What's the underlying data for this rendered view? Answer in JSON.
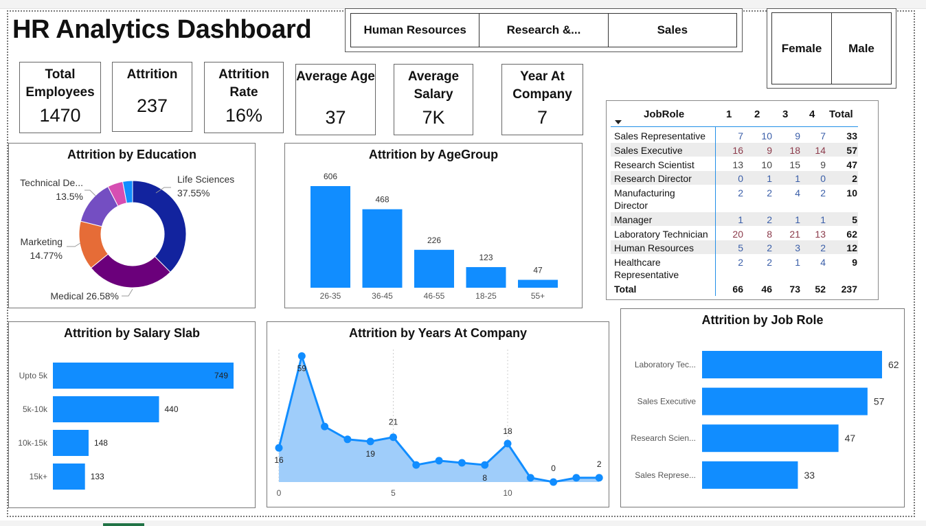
{
  "title": "HR Analytics Dashboard",
  "department_slicer": [
    "Human Resources",
    "Research &...",
    "Sales"
  ],
  "gender_slicer": [
    "Female",
    "Male"
  ],
  "kpis": {
    "total_employees": {
      "label": "Total Employees",
      "value": "1470"
    },
    "attrition": {
      "label": "Attrition",
      "value": "237"
    },
    "attrition_rate": {
      "label": "Attrition Rate",
      "value": "16%"
    },
    "average_age": {
      "label": "Average Age",
      "value": "37"
    },
    "average_salary": {
      "label": "Average Salary",
      "value": "7K"
    },
    "year_at_company": {
      "label": "Year At Company",
      "value": "7"
    }
  },
  "matrix": {
    "headers": [
      "JobRole",
      "1",
      "2",
      "3",
      "4",
      "Total"
    ],
    "rows": [
      {
        "role": "Sales Representative",
        "v": [
          "7",
          "10",
          "9",
          "7"
        ],
        "total": "33"
      },
      {
        "role": "Sales Executive",
        "v": [
          "16",
          "9",
          "18",
          "14"
        ],
        "total": "57"
      },
      {
        "role": "Research Scientist",
        "v": [
          "13",
          "10",
          "15",
          "9"
        ],
        "total": "47"
      },
      {
        "role": "Research Director",
        "v": [
          "0",
          "1",
          "1",
          "0"
        ],
        "total": "2"
      },
      {
        "role": "Manufacturing Director",
        "v": [
          "2",
          "2",
          "4",
          "2"
        ],
        "total": "10"
      },
      {
        "role": "Manager",
        "v": [
          "1",
          "2",
          "1",
          "1"
        ],
        "total": "5"
      },
      {
        "role": "Laboratory Technician",
        "v": [
          "20",
          "8",
          "21",
          "13"
        ],
        "total": "62"
      },
      {
        "role": "Human Resources",
        "v": [
          "5",
          "2",
          "3",
          "2"
        ],
        "total": "12"
      },
      {
        "role": "Healthcare Representative",
        "v": [
          "2",
          "2",
          "1",
          "4"
        ],
        "total": "9"
      }
    ],
    "total_row": {
      "role": "Total",
      "v": [
        "66",
        "46",
        "73",
        "52"
      ],
      "total": "237"
    }
  },
  "colors": {
    "bar": "#118DFF",
    "area": "#9fcdfa",
    "education": [
      "#12239E",
      "#6B007B",
      "#E66C37",
      "#744EC2",
      "#D64EB2",
      "#118DFF"
    ],
    "matrix_blue": "#3a5ea8",
    "matrix_red": "#8b3a4a",
    "matrix_gray": "#444444"
  },
  "chart_data": [
    {
      "type": "pie",
      "title": "Attrition by Education",
      "slices": [
        {
          "label": "Life Sciences",
          "percent_label": "37.55%",
          "value": 37.55
        },
        {
          "label": "Medical",
          "percent_label": "26.58%",
          "value": 26.58
        },
        {
          "label": "Marketing",
          "percent_label": "14.77%",
          "value": 14.77
        },
        {
          "label": "Technical De...",
          "percent_label": "13.5%",
          "value": 13.5
        },
        {
          "label": "",
          "percent_label": "",
          "value": 4.64
        },
        {
          "label": "",
          "percent_label": "",
          "value": 2.96
        }
      ]
    },
    {
      "type": "bar",
      "title": "Attrition by AgeGroup",
      "categories": [
        "26-35",
        "36-45",
        "46-55",
        "18-25",
        "55+"
      ],
      "values": [
        606,
        468,
        226,
        123,
        47
      ]
    },
    {
      "type": "bar",
      "orientation": "horizontal",
      "title": "Attrition by Salary Slab",
      "categories": [
        "Upto 5k",
        "5k-10k",
        "10k-15k",
        "15k+"
      ],
      "values": [
        749,
        440,
        148,
        133
      ]
    },
    {
      "type": "area",
      "title": "Attrition by Years At Company",
      "x": [
        0,
        1,
        2,
        3,
        4,
        5,
        6,
        7,
        8,
        9,
        10,
        11,
        12,
        13,
        14
      ],
      "y": [
        16,
        59,
        26,
        20,
        19,
        21,
        8,
        10,
        9,
        8,
        18,
        2,
        0,
        2,
        2
      ],
      "data_labels": [
        {
          "x": 0,
          "label": "16"
        },
        {
          "x": 1,
          "label": "59"
        },
        {
          "x": 4,
          "label": "19"
        },
        {
          "x": 5,
          "label": "21"
        },
        {
          "x": 9,
          "label": "8"
        },
        {
          "x": 10,
          "label": "18"
        },
        {
          "x": 12,
          "label": "0"
        },
        {
          "x": 14,
          "label": "2"
        }
      ],
      "xticks": [
        0,
        5,
        10
      ]
    },
    {
      "type": "bar",
      "orientation": "horizontal",
      "title": "Attrition by Job Role",
      "categories": [
        "Laboratory Tec...",
        "Sales Executive",
        "Research Scien...",
        "Sales Represe..."
      ],
      "values": [
        62,
        57,
        47,
        33
      ]
    }
  ]
}
